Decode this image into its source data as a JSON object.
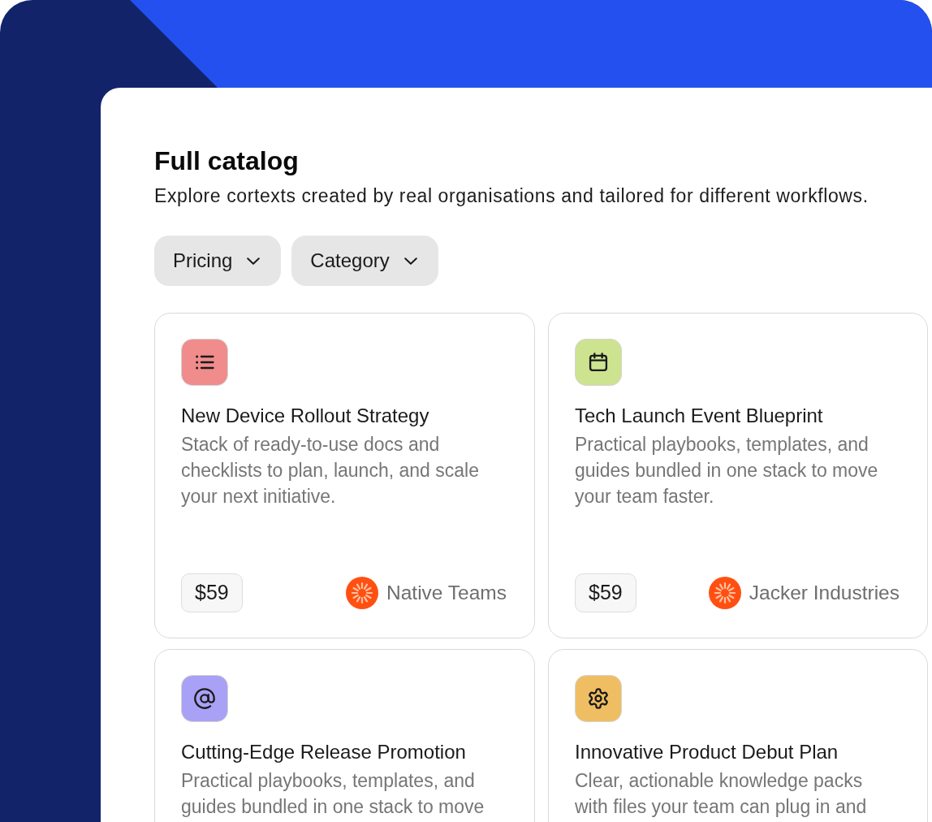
{
  "catalog": {
    "title": "Full catalog",
    "subtitle": "Explore cortexts created by real organisations and tailored for different workflows."
  },
  "filters": [
    {
      "label": "Pricing"
    },
    {
      "label": "Category"
    }
  ],
  "cards": [
    {
      "kind": "list",
      "color": "#f08c8c",
      "title": "New Device Rollout Strategy",
      "description": "Stack of ready-to-use docs and checklists to plan, launch, and scale your next initiative.",
      "price": "$59",
      "organization": "Native Teams"
    },
    {
      "kind": "calendar",
      "color": "#cde390",
      "title": "Tech Launch Event Blueprint",
      "description": "Practical playbooks, templates, and guides bundled in one stack to move your team faster.",
      "price": "$59",
      "organization": "Jacker Industries"
    },
    {
      "kind": "at",
      "color": "#a9a1f6",
      "title": "Cutting-Edge Release Promotion",
      "description": "Practical playbooks, templates, and guides bundled in one stack to move"
    },
    {
      "kind": "gear",
      "color": "#f0be62",
      "title": "Innovative Product Debut Plan",
      "description": "Clear, actionable knowledge packs with files your team can plug in and"
    }
  ]
}
